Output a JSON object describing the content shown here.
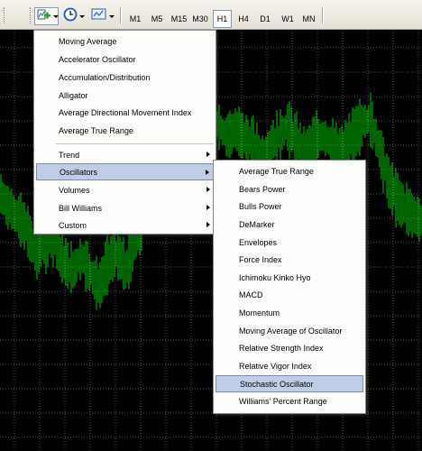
{
  "toolbar": {
    "buttons": [
      {
        "name": "add-indicator",
        "icon": "indicators-plus-icon"
      },
      {
        "name": "periodicity",
        "icon": "clock-icon"
      },
      {
        "name": "templates",
        "icon": "chart-template-icon"
      }
    ],
    "timeframes": [
      "M1",
      "M5",
      "M15",
      "M30",
      "H1",
      "H4",
      "D1",
      "W1",
      "MN"
    ],
    "active_timeframe": "H1"
  },
  "indicator_menu": {
    "items": [
      {
        "label": "Moving Average"
      },
      {
        "label": "Accelerator Oscillator"
      },
      {
        "label": "Accumulation/Distribution"
      },
      {
        "label": "Alligator"
      },
      {
        "label": "Average Directional Movement Index"
      },
      {
        "label": "Average True Range"
      }
    ],
    "groups": [
      {
        "label": "Trend"
      },
      {
        "label": "Oscillators"
      },
      {
        "label": "Volumes"
      },
      {
        "label": "Bill Williams"
      },
      {
        "label": "Custom"
      }
    ]
  },
  "oscillators_menu": {
    "items": [
      {
        "label": "Average True Range"
      },
      {
        "label": "Bears Power"
      },
      {
        "label": "Bulls Power"
      },
      {
        "label": "DeMarker"
      },
      {
        "label": "Envelopes"
      },
      {
        "label": "Force Index"
      },
      {
        "label": "Ichimoku Kinko Hyo"
      },
      {
        "label": "MACD"
      },
      {
        "label": "Momentum"
      },
      {
        "label": "Moving Average of Oscillator"
      },
      {
        "label": "Relative Strength Index"
      },
      {
        "label": "Relative Vigor Index"
      },
      {
        "label": "Stochastic Oscillator"
      },
      {
        "label": "Williams' Percent Range"
      }
    ],
    "highlighted": "Stochastic Oscillator"
  },
  "colors": {
    "chart_background": "#000000",
    "grid": "#5a5a5a",
    "candles": "#00c800",
    "menu_highlight": "#c1cde4",
    "menu_highlight_border": "#7b8ab0"
  }
}
